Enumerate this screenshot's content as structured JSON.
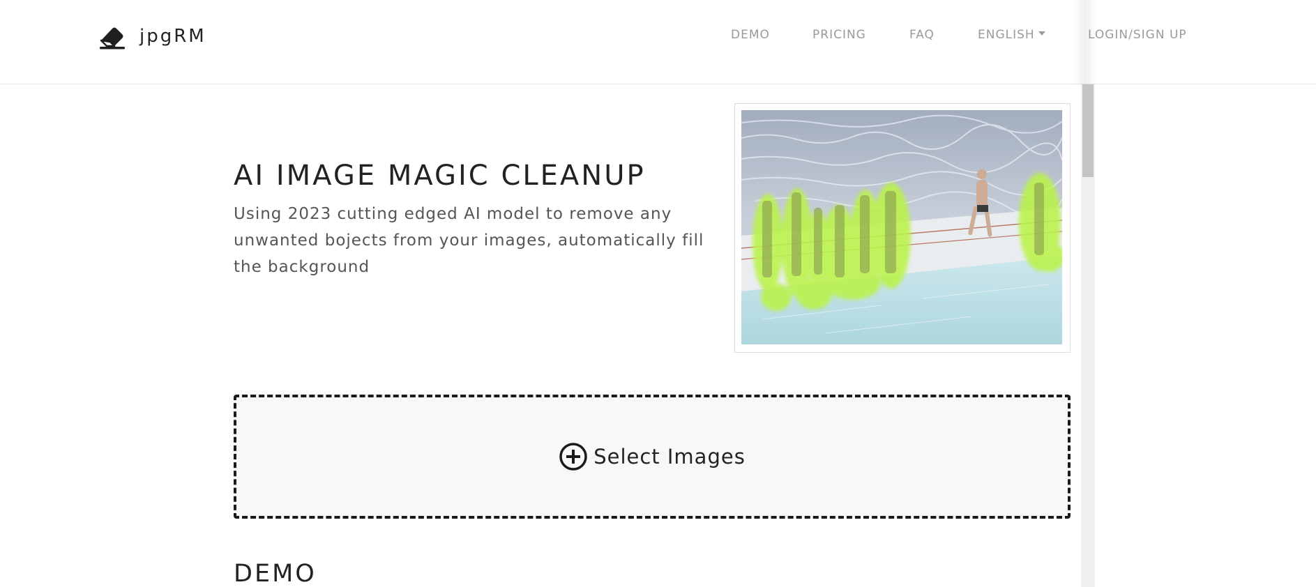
{
  "brand": {
    "name": "jpgRM",
    "icon": "eraser-icon"
  },
  "nav": {
    "demo": "DEMO",
    "pricing": "PRICING",
    "faq": "FAQ",
    "language": "ENGLISH",
    "login": "LOGIN/SIGN UP"
  },
  "hero": {
    "title": "AI IMAGE MAGIC CLEANUP",
    "subtitle": "Using 2023 cutting edged AI model to remove any unwanted bojects from your images, automatically fill the background"
  },
  "upload": {
    "label": "Select Images",
    "icon": "plus-circle-icon"
  },
  "sections": {
    "demo_title": "DEMO"
  },
  "colors": {
    "mask_highlight": "#b5f23a",
    "text_primary": "#222222",
    "nav_text": "#9a9a9a",
    "dropzone_bg": "#f8f8f8"
  }
}
